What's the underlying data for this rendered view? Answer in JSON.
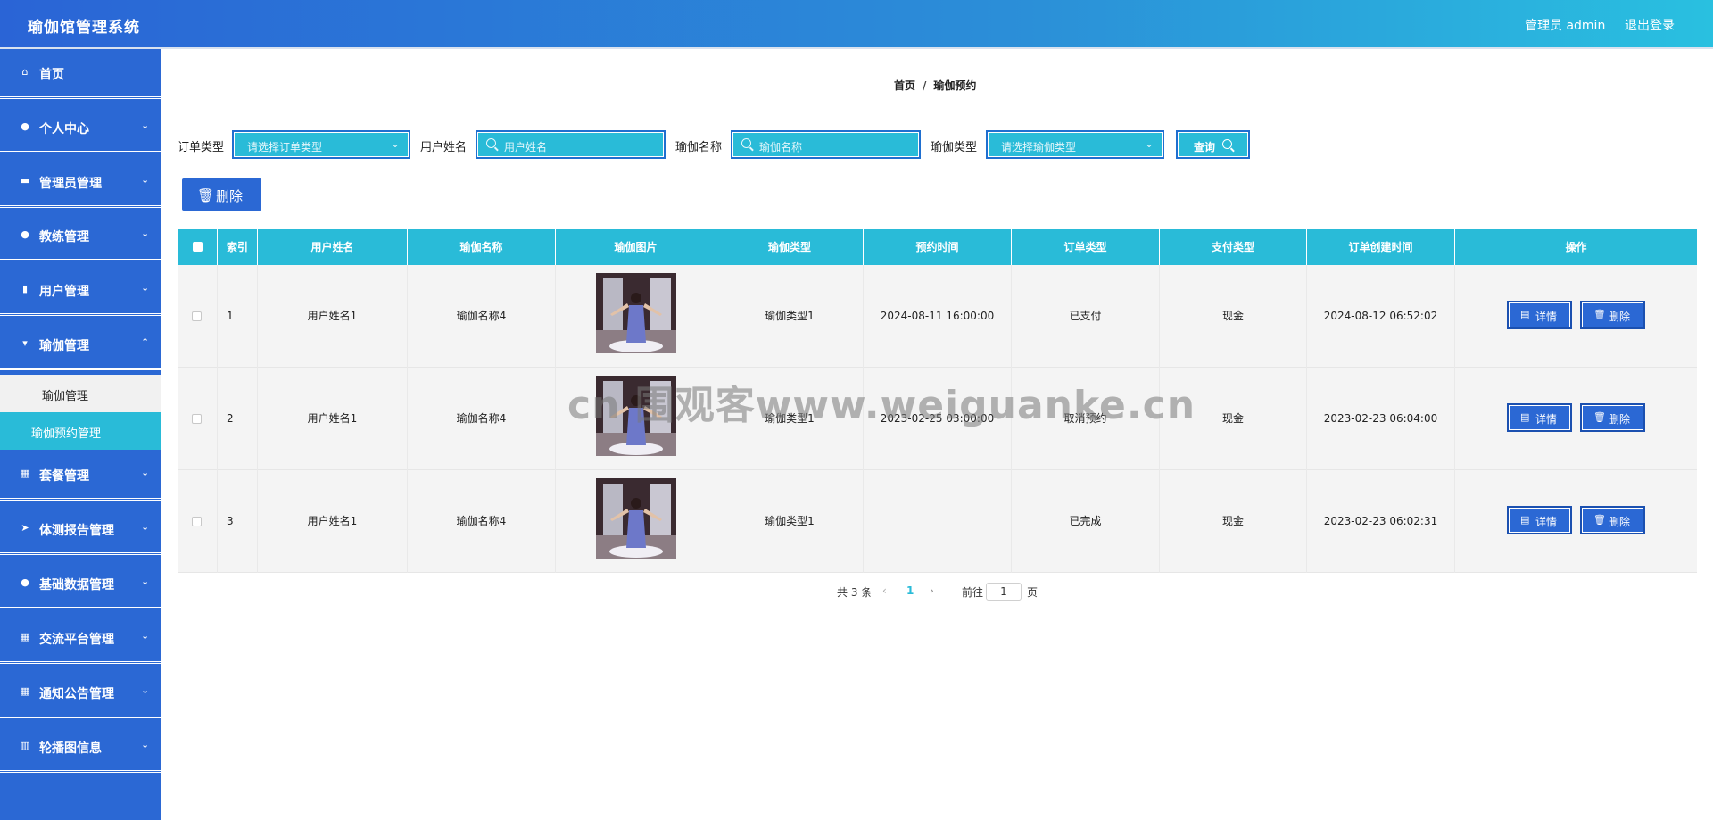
{
  "header": {
    "title": "瑜伽馆管理系统",
    "user_label": "管理员 admin",
    "logout_label": "退出登录"
  },
  "sidebar": {
    "items": [
      {
        "label": "首页",
        "icon": "home-icon"
      },
      {
        "label": "个人中心",
        "icon": "user-icon"
      },
      {
        "label": "管理员管理",
        "icon": "monitor-icon"
      },
      {
        "label": "教练管理",
        "icon": "user-icon"
      },
      {
        "label": "用户管理",
        "icon": "clipboard-icon"
      },
      {
        "label": "瑜伽管理",
        "icon": "flag-icon"
      },
      {
        "label": "套餐管理",
        "icon": "grid-icon"
      },
      {
        "label": "体测报告管理",
        "icon": "send-icon"
      },
      {
        "label": "基础数据管理",
        "icon": "location-icon"
      },
      {
        "label": "交流平台管理",
        "icon": "grid-icon"
      },
      {
        "label": "通知公告管理",
        "icon": "grid-icon"
      },
      {
        "label": "轮播图信息",
        "icon": "chart-icon"
      }
    ],
    "sub_items": [
      {
        "label": "瑜伽管理"
      },
      {
        "label": "瑜伽预约管理"
      }
    ]
  },
  "breadcrumb": {
    "home": "首页",
    "separator": "/",
    "current": "瑜伽预约"
  },
  "filters": {
    "order_type": {
      "label": "订单类型",
      "placeholder": "请选择订单类型"
    },
    "user_name": {
      "label": "用户姓名",
      "placeholder": "用户姓名"
    },
    "yoga_name": {
      "label": "瑜伽名称",
      "placeholder": "瑜伽名称"
    },
    "yoga_type": {
      "label": "瑜伽类型",
      "placeholder": "请选择瑜伽类型"
    },
    "query_label": "查询"
  },
  "toolbar": {
    "delete_label": "删除"
  },
  "table": {
    "headers": [
      "索引",
      "用户姓名",
      "瑜伽名称",
      "瑜伽图片",
      "瑜伽类型",
      "预约时间",
      "订单类型",
      "支付类型",
      "订单创建时间",
      "操作"
    ],
    "rows": [
      {
        "index": "1",
        "user_name": "用户姓名1",
        "yoga_name": "瑜伽名称4",
        "yoga_type": "瑜伽类型1",
        "booking_time": "2024-08-11 16:00:00",
        "order_type": "已支付",
        "pay_type": "现金",
        "created": "2024-08-12 06:52:02"
      },
      {
        "index": "2",
        "user_name": "用户姓名1",
        "yoga_name": "瑜伽名称4",
        "yoga_type": "瑜伽类型1",
        "booking_time": "2023-02-25 03:00:00",
        "order_type": "取消预约",
        "pay_type": "现金",
        "created": "2023-02-23 06:04:00"
      },
      {
        "index": "3",
        "user_name": "用户姓名1",
        "yoga_name": "瑜伽名称4",
        "yoga_type": "瑜伽类型1",
        "booking_time": "",
        "order_type": "已完成",
        "pay_type": "现金",
        "created": "2023-02-23 06:02:31"
      }
    ],
    "detail_label": "详情",
    "delete_label": "删除"
  },
  "pagination": {
    "total": "共 3 条",
    "current_page": "1",
    "goto_label": "前往",
    "goto_value": "1",
    "page_suffix": "页"
  },
  "watermark": "cn 围观客www.weiguanke.cn",
  "colors": {
    "primary": "#2b68d4",
    "accent": "#29bbd8"
  }
}
